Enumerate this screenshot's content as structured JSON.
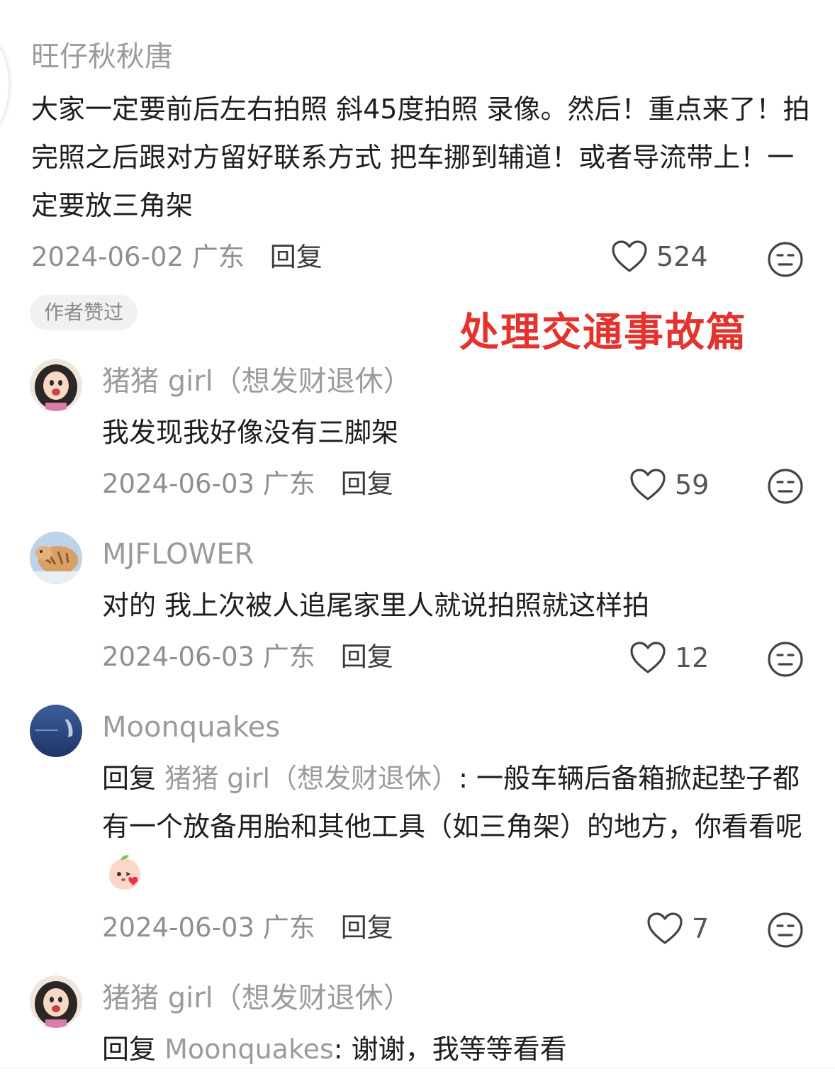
{
  "overlay_title": "处理交通事故篇",
  "comments": [
    {
      "username": "旺仔秋秋唐",
      "text": "大家一定要前后左右拍照 斜45度拍照 录像。然后！重点来了！拍完照之后跟对方留好联系方式 把车挪到辅道！或者导流带上！一定要放三角架",
      "date": "2024-06-02",
      "location": "广东",
      "reply_label": "回复",
      "likes": "524",
      "badge": "作者赞过"
    },
    {
      "username": "猪猪 girl（想发财退休）",
      "text": "我发现我好像没有三脚架",
      "date": "2024-06-03",
      "location": "广东",
      "reply_label": "回复",
      "likes": "59"
    },
    {
      "username": "MJFLOWER",
      "text": "对的 我上次被人追尾家里人就说拍照就这样拍",
      "date": "2024-06-03",
      "location": "广东",
      "reply_label": "回复",
      "likes": "12"
    },
    {
      "username": "Moonquakes",
      "reply_prefix": "回复",
      "reply_to": "猪猪 girl（想发财退休）",
      "text": ": 一般车辆后备箱掀起垫子都有一个放备用胎和其他工具（如三角架）的地方，你看看呢",
      "date": "2024-06-03",
      "location": "广东",
      "reply_label": "回复",
      "likes": "7"
    },
    {
      "username": "猪猪 girl（想发财退休）",
      "reply_prefix": "回复",
      "reply_to": "Moonquakes",
      "text": ": 谢谢，我等等看看"
    }
  ],
  "icons": {
    "like": "heart-outline-icon",
    "emoji": "neutral-face-icon",
    "sticker": "peach-blush-emoji-icon"
  },
  "colors": {
    "accent_red": "#e4322e",
    "muted_text": "#9b9b9b"
  }
}
